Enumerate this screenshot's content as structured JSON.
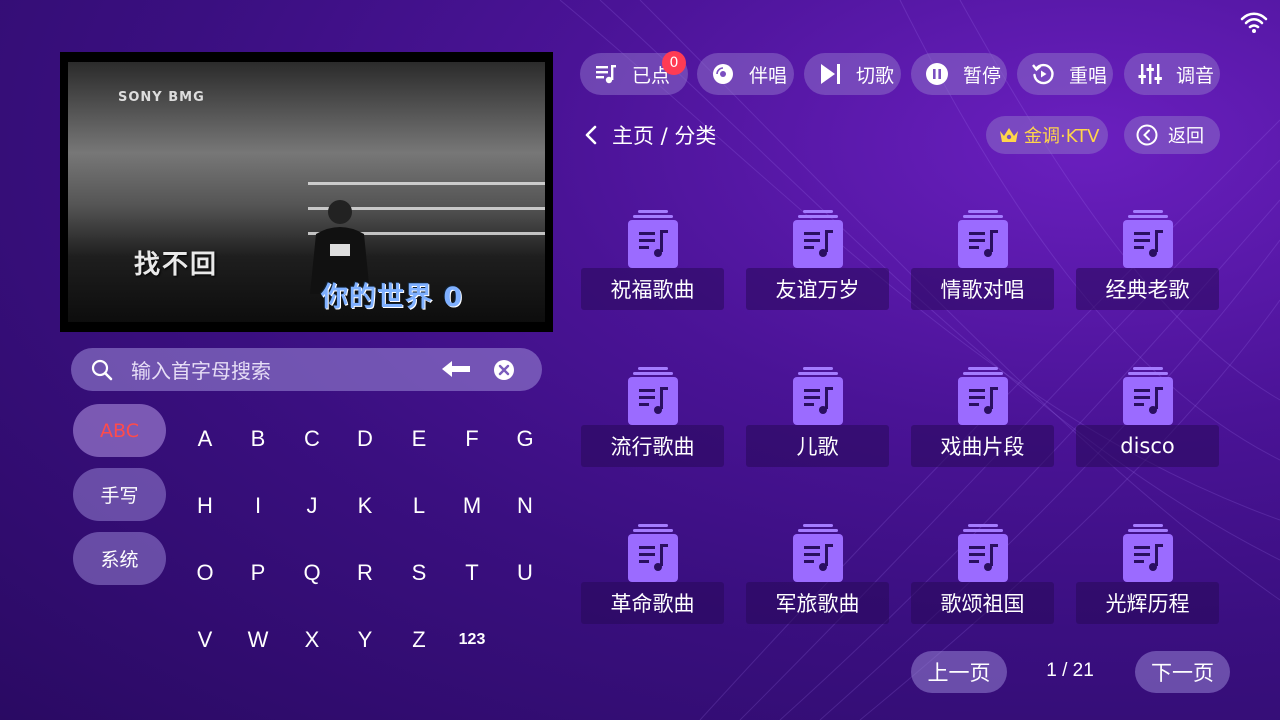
{
  "topbar": {
    "buttons": [
      {
        "label": "已点",
        "icon": "playlist-icon",
        "badge": "0"
      },
      {
        "label": "伴唱",
        "icon": "disc-icon"
      },
      {
        "label": "切歌",
        "icon": "skip-icon"
      },
      {
        "label": "暂停",
        "icon": "pause-icon"
      },
      {
        "label": "重唱",
        "icon": "replay-icon"
      },
      {
        "label": "调音",
        "icon": "equalizer-icon"
      }
    ]
  },
  "video": {
    "lyric_left": "找不回",
    "lyric_right": "你的世界 0",
    "logo_text": "SONY BMG"
  },
  "breadcrumb": "主页 / 分类",
  "vip_label": "金调·KTV",
  "back_label": "返回",
  "categories": [
    "祝福歌曲",
    "友谊万岁",
    "情歌对唱",
    "经典老歌",
    "流行歌曲",
    "儿歌",
    "戏曲片段",
    "disco",
    "革命歌曲",
    "军旅歌曲",
    "歌颂祖国",
    "光辉历程"
  ],
  "search": {
    "placeholder": "输入首字母搜索",
    "value": ""
  },
  "modes": [
    {
      "label": "ABC",
      "active": true
    },
    {
      "label": "手写",
      "active": false
    },
    {
      "label": "系统",
      "active": false
    }
  ],
  "keys": [
    "A",
    "B",
    "C",
    "D",
    "E",
    "F",
    "G",
    "H",
    "I",
    "J",
    "K",
    "L",
    "M",
    "N",
    "O",
    "P",
    "Q",
    "R",
    "S",
    "T",
    "U",
    "V",
    "W",
    "X",
    "Y",
    "Z",
    "123"
  ],
  "pagination": {
    "prev": "上一页",
    "next": "下一页",
    "page": "1 / 21"
  },
  "colors": {
    "accent": "#8e5cf0",
    "badge": "#ff3b54",
    "vip": "#ffd54a",
    "active_mode": "#ff4b4b"
  }
}
